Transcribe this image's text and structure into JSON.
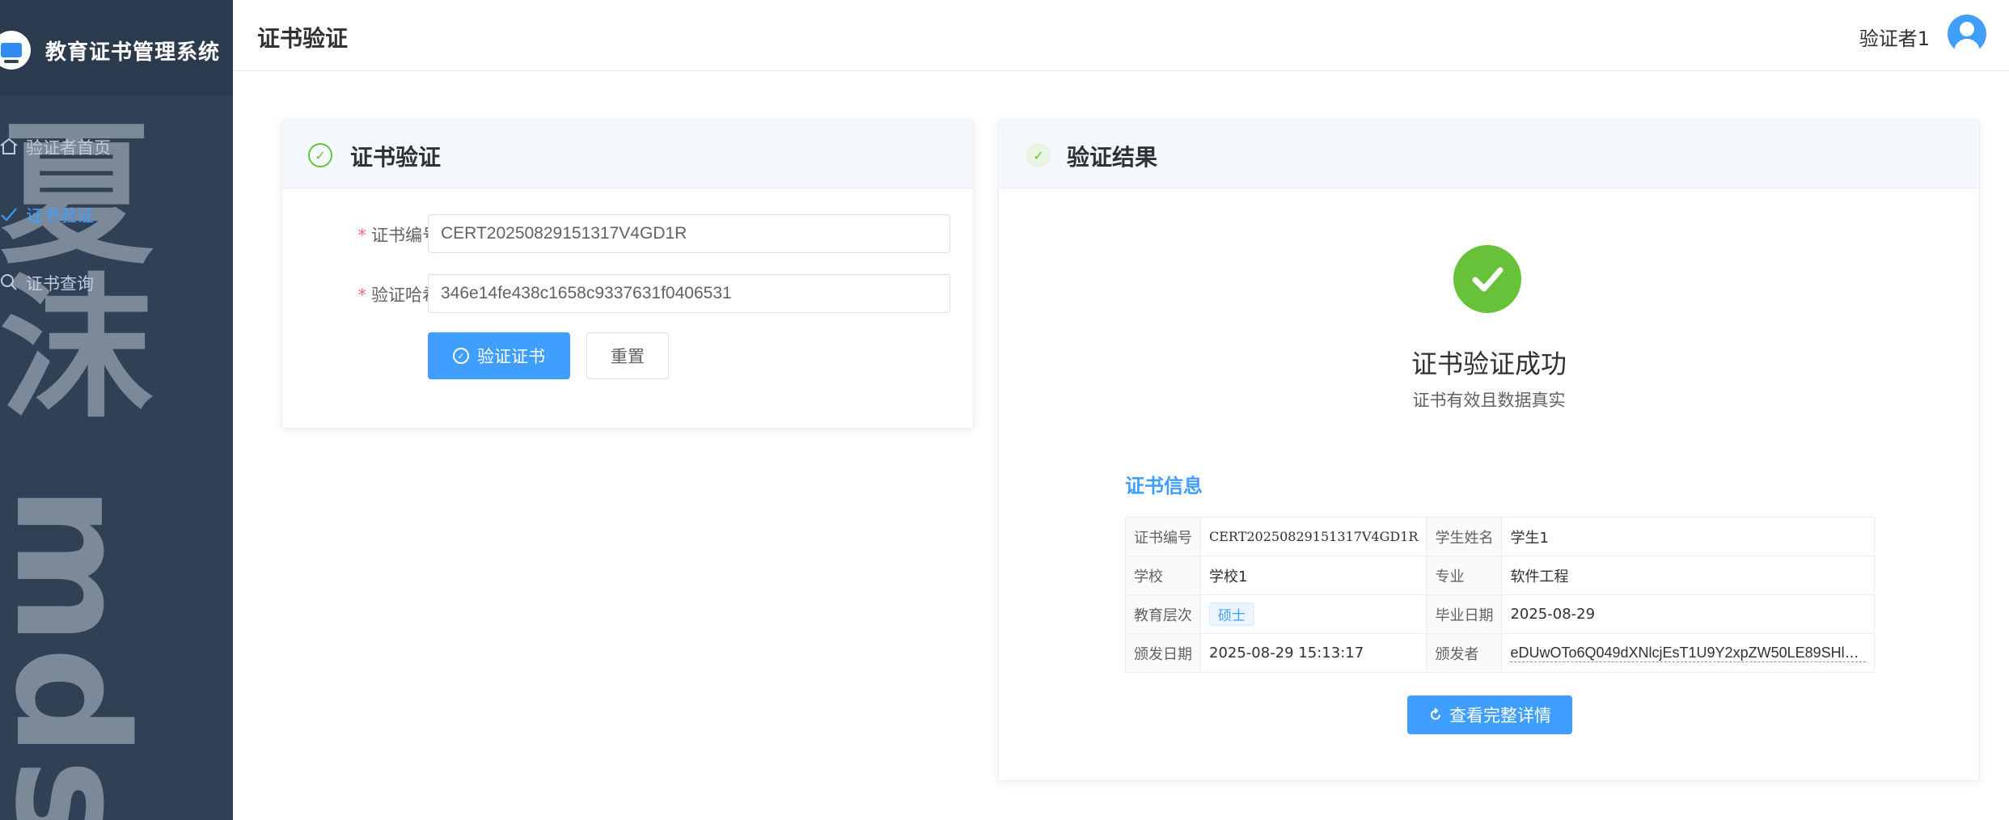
{
  "app": {
    "title": "教育证书管理系统",
    "watermark_cn": "夏沫",
    "watermark_en": "mds"
  },
  "sidebar": {
    "items": [
      {
        "label": "验证者首页",
        "icon": "home-icon",
        "active": false
      },
      {
        "label": "证书验证",
        "icon": "check-icon",
        "active": true
      },
      {
        "label": "证书查询",
        "icon": "search-icon",
        "active": false
      }
    ]
  },
  "header": {
    "title": "证书验证",
    "user": "验证者1"
  },
  "verify_form": {
    "title": "证书验证",
    "cert_no_label": "证书编号",
    "cert_no_value": "CERT20250829151317V4GD1R",
    "hash_label": "验证哈希",
    "hash_value": "346e14fe438c1658c9337631f0406531",
    "verify_button": "验证证书",
    "reset_button": "重置"
  },
  "result": {
    "title": "验证结果",
    "status_title": "证书验证成功",
    "status_sub": "证书有效且数据真实",
    "info_title": "证书信息",
    "rows": [
      {
        "k1": "证书编号",
        "v1": "CERT20250829151317V4GD1R",
        "k2": "学生姓名",
        "v2": "学生1"
      },
      {
        "k1": "学校",
        "v1": "学校1",
        "k2": "专业",
        "v2": "软件工程"
      },
      {
        "k1": "教育层次",
        "v1": "硕士",
        "k2": "毕业日期",
        "v2": "2025-08-29"
      },
      {
        "k1": "颁发日期",
        "v1": "2025-08-29 15:13:17",
        "k2": "颁发者",
        "v2": "eDUwOTo6Q049dXNlcjEsT1U9Y2xpZW50LE89SHlw..."
      }
    ],
    "detail_button": "查看完整详情"
  },
  "colors": {
    "sidebar_bg": "#304156",
    "primary": "#409eff",
    "success": "#67c23a"
  }
}
